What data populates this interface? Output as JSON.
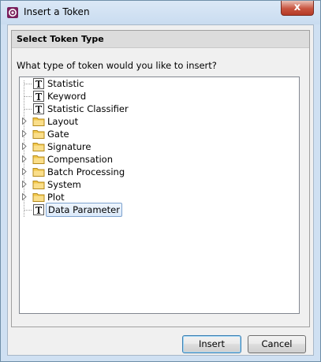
{
  "window": {
    "title": "Insert a Token",
    "close_glyph": "x",
    "app_icon": "app-logo-icon"
  },
  "group": {
    "title": "Select Token Type",
    "question": "What type of token would you like to insert?"
  },
  "tree": {
    "items": [
      {
        "label": "Statistic",
        "icon": "text-token-icon",
        "expandable": false,
        "selected": false
      },
      {
        "label": "Keyword",
        "icon": "text-token-icon",
        "expandable": false,
        "selected": false
      },
      {
        "label": "Statistic Classifier",
        "icon": "text-token-icon",
        "expandable": false,
        "selected": false
      },
      {
        "label": "Layout",
        "icon": "folder-icon",
        "expandable": true,
        "selected": false
      },
      {
        "label": "Gate",
        "icon": "folder-icon",
        "expandable": true,
        "selected": false
      },
      {
        "label": "Signature",
        "icon": "folder-icon",
        "expandable": true,
        "selected": false
      },
      {
        "label": "Compensation",
        "icon": "folder-icon",
        "expandable": true,
        "selected": false
      },
      {
        "label": "Batch Processing",
        "icon": "folder-icon",
        "expandable": true,
        "selected": false
      },
      {
        "label": "System",
        "icon": "folder-icon",
        "expandable": true,
        "selected": false
      },
      {
        "label": "Plot",
        "icon": "folder-icon",
        "expandable": true,
        "selected": false
      },
      {
        "label": "Data Parameter",
        "icon": "text-token-icon",
        "expandable": false,
        "selected": true
      }
    ]
  },
  "buttons": {
    "insert_label": "Insert",
    "cancel_label": "Cancel"
  },
  "colors": {
    "folder": "#f3c84a",
    "selection_border": "#7da2ce",
    "default_button_border": "#3c7fb1"
  }
}
